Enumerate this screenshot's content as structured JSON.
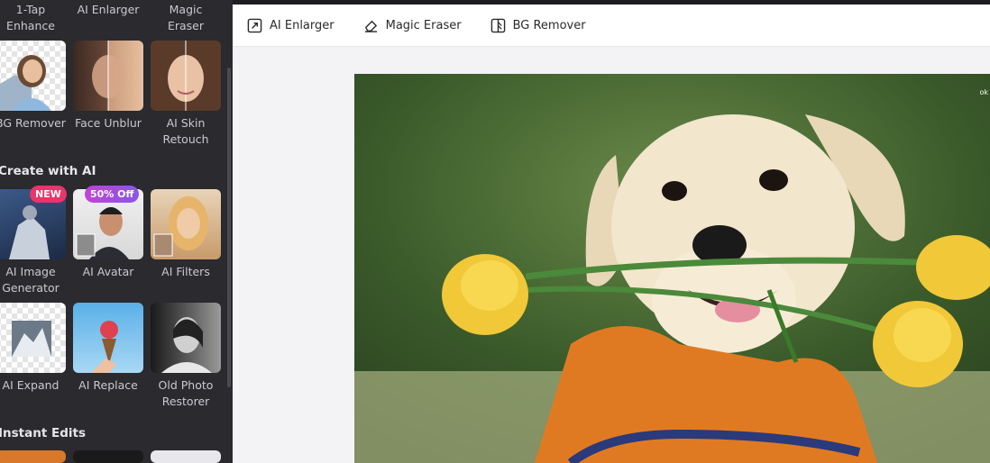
{
  "sidebar": {
    "top_tools": [
      {
        "label": "1-Tap\nEnhance"
      },
      {
        "label": "AI Enlarger"
      },
      {
        "label": "Magic Eraser"
      }
    ],
    "row2": [
      {
        "label": "BG Remover"
      },
      {
        "label": "Face Unblur"
      },
      {
        "label": "AI Skin\nRetouch"
      }
    ],
    "section_create": "Create with AI",
    "row3": [
      {
        "label": "AI Image\nGenerator",
        "badge": "NEW"
      },
      {
        "label": "AI Avatar",
        "badge": "50% Off"
      },
      {
        "label": "AI Filters"
      }
    ],
    "row4": [
      {
        "label": "AI Expand"
      },
      {
        "label": "AI Replace"
      },
      {
        "label": "Old Photo\nRestorer"
      }
    ],
    "section_instant": "Instant Edits"
  },
  "toolbar": {
    "enlarger": "AI Enlarger",
    "eraser": "Magic Eraser",
    "bg_remover": "BG Remover"
  },
  "collapse_icon": "chevron-left-icon",
  "colors": {
    "sidebar_bg": "#2a2a2f",
    "badge_new": "#e8356b",
    "badge_off": "#a64dd8"
  }
}
